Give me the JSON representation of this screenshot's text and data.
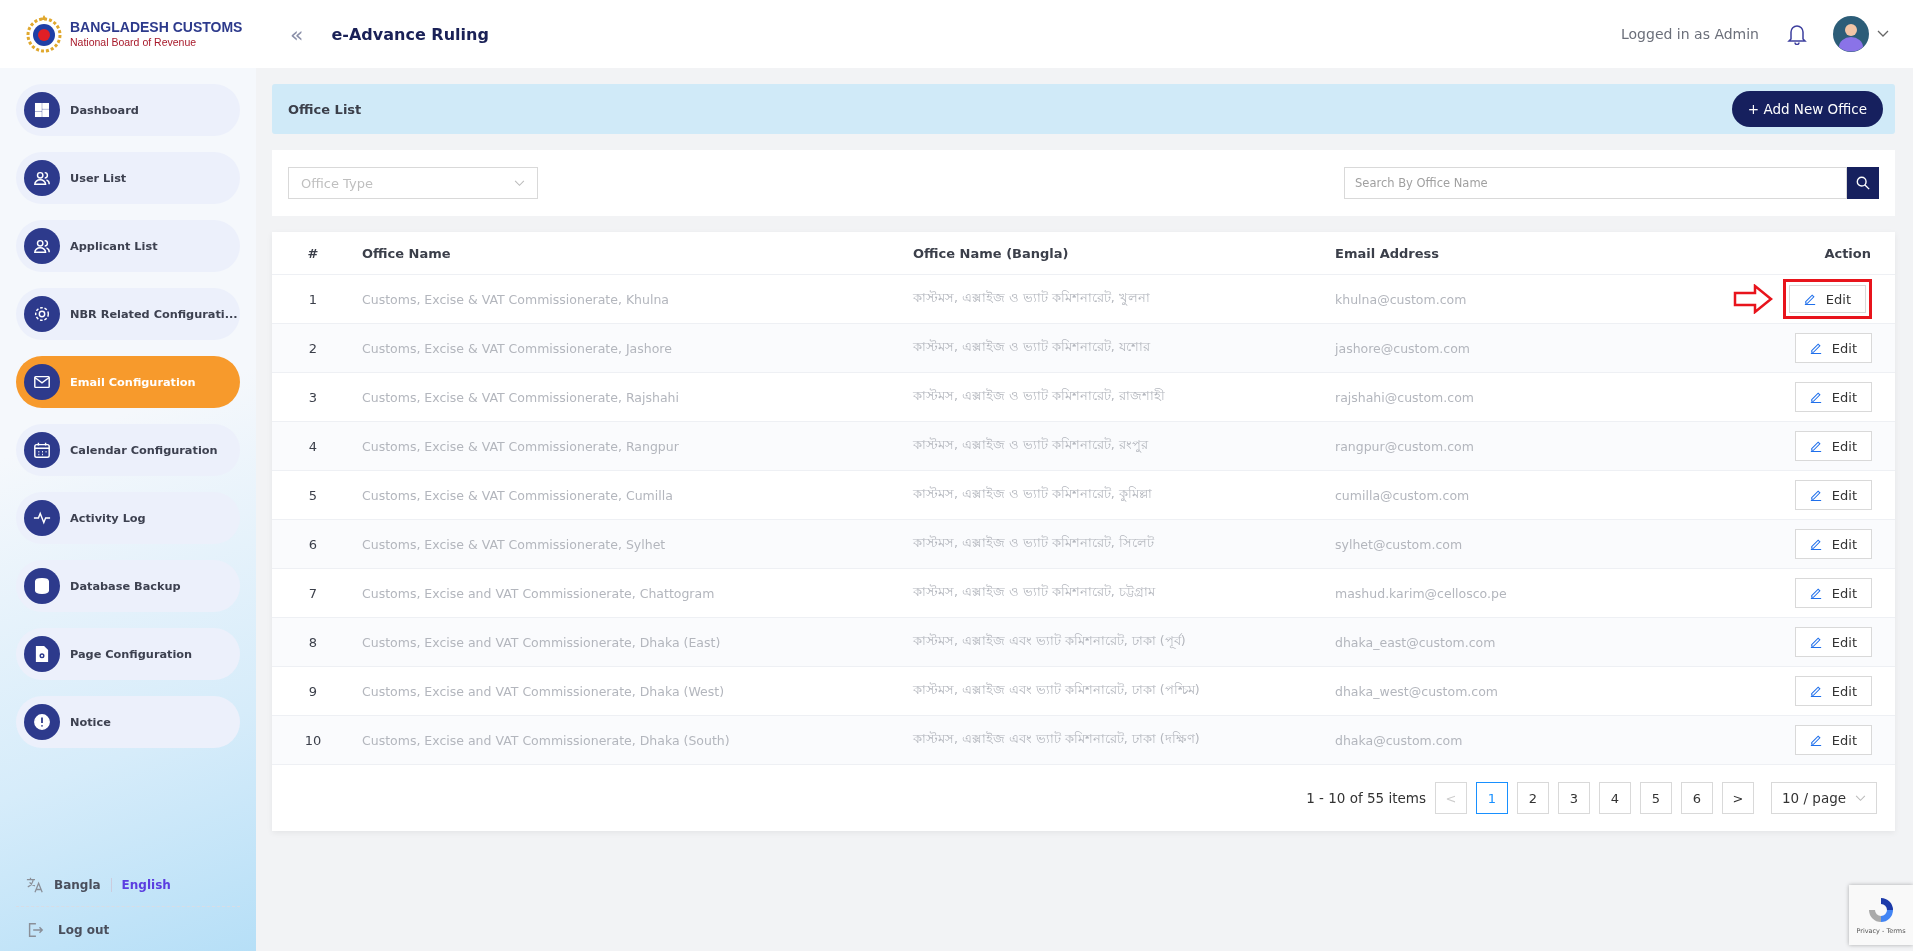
{
  "brand": {
    "title": "BANGLADESH CUSTOMS",
    "subtitle": "National Board of Revenue"
  },
  "header": {
    "collapse": "«",
    "app_title": "e-Advance Ruling",
    "user_label": "Logged in as Admin"
  },
  "sidebar": {
    "items": [
      {
        "label": "Dashboard",
        "selected": false
      },
      {
        "label": "User List",
        "selected": false
      },
      {
        "label": "Applicant List",
        "selected": false
      },
      {
        "label": "NBR Related Configurati...",
        "selected": false
      },
      {
        "label": "Email Configuration",
        "selected": true
      },
      {
        "label": "Calendar Configuration",
        "selected": false
      },
      {
        "label": "Activity Log",
        "selected": false
      },
      {
        "label": "Database Backup",
        "selected": false
      },
      {
        "label": "Page Configuration",
        "selected": false
      },
      {
        "label": "Notice",
        "selected": false
      }
    ],
    "languages": [
      {
        "label": "Bangla",
        "selected": false
      },
      {
        "label": "English",
        "selected": true
      }
    ],
    "logout": "Log out"
  },
  "page": {
    "title": "Office List",
    "add_button": "+ Add New Office"
  },
  "filters": {
    "office_type": {
      "placeholder": "Office Type"
    },
    "search": {
      "placeholder": "Search By Office Name"
    }
  },
  "table": {
    "columns": [
      "#",
      "Office Name",
      "Office Name (Bangla)",
      "Email Address",
      "Action"
    ],
    "rows": [
      {
        "no": "1",
        "name": "Customs, Excise & VAT Commissionerate, Khulna",
        "name_bn": "কাস্টমস, এক্সাইজ ও ভ্যাট কমিশনারেট, খুলনা",
        "email": "khulna@custom.com",
        "action": "Edit",
        "highlighted": true
      },
      {
        "no": "2",
        "name": "Customs, Excise & VAT Commissionerate, Jashore",
        "name_bn": "কাস্টমস, এক্সাইজ ও ভ্যাট কমিশনারেট, যশোর",
        "email": "jashore@custom.com",
        "action": "Edit",
        "highlighted": false
      },
      {
        "no": "3",
        "name": "Customs, Excise & VAT Commissionerate, Rajshahi",
        "name_bn": "কাস্টমস, এক্সাইজ ও ভ্যাট কমিশনারেট, রাজশাহী",
        "email": "rajshahi@custom.com",
        "action": "Edit",
        "highlighted": false
      },
      {
        "no": "4",
        "name": "Customs, Excise & VAT Commissionerate, Rangpur",
        "name_bn": "কাস্টমস, এক্সাইজ ও ভ্যাট কমিশনারেট, রংপুর",
        "email": "rangpur@custom.com",
        "action": "Edit",
        "highlighted": false
      },
      {
        "no": "5",
        "name": "Customs, Excise & VAT Commissionerate, Cumilla",
        "name_bn": "কাস্টমস, এক্সাইজ ও ভ্যাট কমিশনারেট, কুমিল্লা",
        "email": "cumilla@custom.com",
        "action": "Edit",
        "highlighted": false
      },
      {
        "no": "6",
        "name": "Customs, Excise & VAT Commissionerate, Sylhet",
        "name_bn": "কাস্টমস, এক্সাইজ ও ভ্যাট কমিশনারেট, সিলেট",
        "email": "sylhet@custom.com",
        "action": "Edit",
        "highlighted": false
      },
      {
        "no": "7",
        "name": "Customs, Excise and VAT Commissionerate, Chattogram",
        "name_bn": "কাস্টমস, এক্সাইজ ও ভ্যাট কমিশনারেট, চট্টগ্রাম",
        "email": "mashud.karim@cellosco.pe",
        "action": "Edit",
        "highlighted": false
      },
      {
        "no": "8",
        "name": "Customs, Excise and VAT Commissionerate, Dhaka (East)",
        "name_bn": "কাস্টমস, এক্সাইজ এবং ভ্যাট কমিশনারেট, ঢাকা (পূর্ব)",
        "email": "dhaka_east@custom.com",
        "action": "Edit",
        "highlighted": false
      },
      {
        "no": "9",
        "name": "Customs, Excise and VAT Commissionerate, Dhaka (West)",
        "name_bn": "কাস্টমস, এক্সাইজ এবং ভ্যাট কমিশনারেট, ঢাকা (পশ্চিম)",
        "email": "dhaka_west@custom.com",
        "action": "Edit",
        "highlighted": false
      },
      {
        "no": "10",
        "name": "Customs, Excise and VAT Commissionerate, Dhaka (South)",
        "name_bn": "কাস্টমস, এক্সাইজ এবং ভ্যাট কমিশনারেট, ঢাকা (দক্ষিণ)",
        "email": "dhaka@custom.com",
        "action": "Edit",
        "highlighted": false
      }
    ]
  },
  "pagination": {
    "summary": "1 - 10 of 55 items",
    "prev": "<",
    "next": ">",
    "pages": [
      {
        "label": "1",
        "selected": true
      },
      {
        "label": "2",
        "selected": false
      },
      {
        "label": "3",
        "selected": false
      },
      {
        "label": "4",
        "selected": false
      },
      {
        "label": "5",
        "selected": false
      },
      {
        "label": "6",
        "selected": false
      }
    ],
    "page_size": "10 / page"
  },
  "recaptcha": {
    "text": "Privacy - Terms"
  }
}
